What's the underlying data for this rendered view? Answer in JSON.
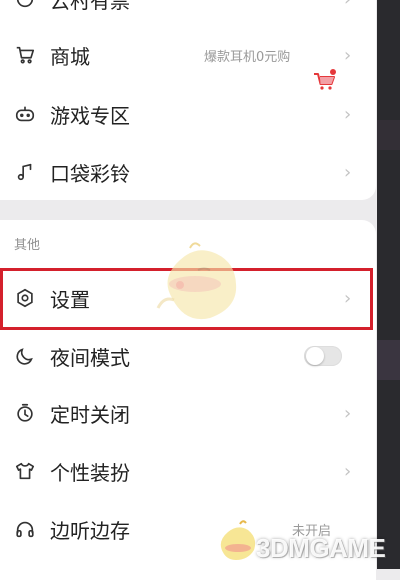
{
  "top_cut_item": {
    "label": "云村有票"
  },
  "menu_top": [
    {
      "label": "商城",
      "hint": "爆款耳机0元购",
      "icon": "cart-icon"
    },
    {
      "label": "游戏专区",
      "icon": "gamepad-icon"
    },
    {
      "label": "口袋彩铃",
      "icon": "music-note-icon"
    }
  ],
  "section": {
    "title": "其他"
  },
  "menu_other": [
    {
      "label": "设置",
      "icon": "settings-icon",
      "highlighted": true
    },
    {
      "label": "夜间模式",
      "icon": "moon-icon",
      "toggle_on": false
    },
    {
      "label": "定时关闭",
      "icon": "timer-icon"
    },
    {
      "label": "个性装扮",
      "icon": "tshirt-icon"
    },
    {
      "label": "边听边存",
      "icon": "headphones-icon",
      "status": "未开启"
    }
  ],
  "chevron": "›",
  "watermark": {
    "text": "3DMGAME"
  },
  "colors": {
    "highlight": "#d4202c",
    "accent_red": "#e5383b"
  }
}
